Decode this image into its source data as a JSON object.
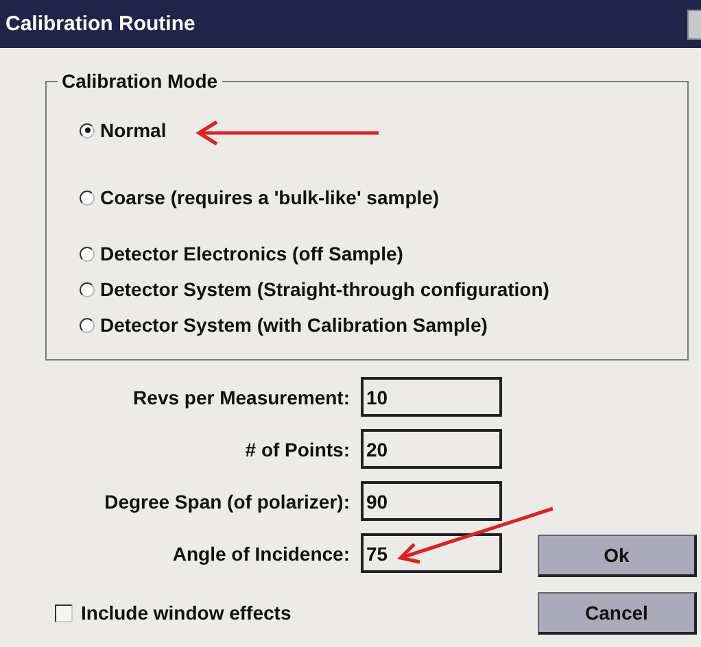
{
  "window": {
    "title": "Calibration Routine"
  },
  "calibration_mode": {
    "label": "Calibration Mode",
    "options": [
      {
        "label": "Normal",
        "selected": true
      },
      {
        "label": "Coarse (requires a 'bulk-like' sample)",
        "selected": false
      },
      {
        "label": "Detector Electronics (off Sample)",
        "selected": false
      },
      {
        "label": "Detector System (Straight-through configuration)",
        "selected": false
      },
      {
        "label": "Detector System (with Calibration Sample)",
        "selected": false
      }
    ]
  },
  "fields": [
    {
      "label": "Revs per Measurement:",
      "value": "10"
    },
    {
      "label": "# of Points:",
      "value": "20"
    },
    {
      "label": "Degree Span (of polarizer):",
      "value": "90"
    },
    {
      "label": "Angle of Incidence:",
      "value": "75"
    }
  ],
  "include_window_effects": {
    "label": "Include window effects",
    "checked": false
  },
  "buttons": [
    "Ok",
    "Cancel"
  ]
}
